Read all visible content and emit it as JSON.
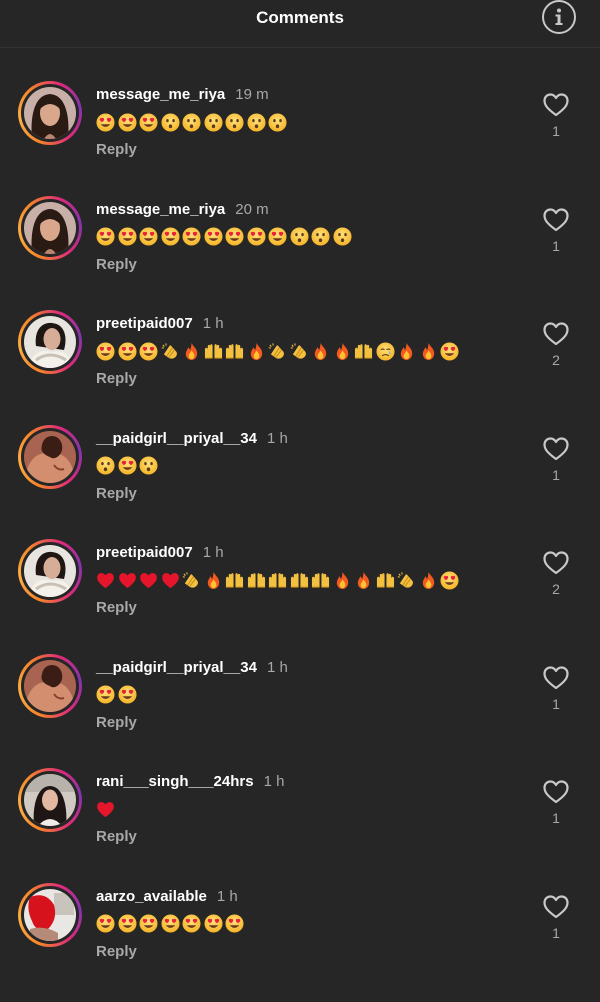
{
  "header": {
    "title": "Comments",
    "info_icon": "info-icon"
  },
  "colors": {
    "background": "#262626",
    "ring_gradient": [
      "#f58529",
      "#dd2a7b",
      "#8134af"
    ],
    "muted_text": "#a8a8a8"
  },
  "comments": [
    {
      "username": "message_me_riya",
      "time": "19 m",
      "reply_label": "Reply",
      "likes": "1",
      "avatar": "portrait-woman-dark-hair",
      "emojis": [
        "heart-eyes",
        "heart-eyes",
        "heart-eyes",
        "astonished",
        "astonished",
        "astonished",
        "astonished",
        "astonished",
        "astonished"
      ]
    },
    {
      "username": "message_me_riya",
      "time": "20 m",
      "reply_label": "Reply",
      "likes": "1",
      "avatar": "portrait-woman-dark-hair",
      "emojis": [
        "heart-eyes",
        "heart-eyes",
        "heart-eyes",
        "heart-eyes",
        "heart-eyes",
        "heart-eyes",
        "heart-eyes",
        "heart-eyes",
        "heart-eyes",
        "astonished",
        "astonished",
        "astonished"
      ]
    },
    {
      "username": "preetipaid007",
      "time": "1 h",
      "reply_label": "Reply",
      "likes": "2",
      "avatar": "portrait-woman-scarf",
      "emojis": [
        "heart-eyes",
        "heart-eyes",
        "heart-eyes",
        "clap",
        "fire",
        "raised-hands",
        "raised-hands",
        "fire",
        "clap",
        "clap",
        "fire",
        "fire",
        "raised-hands",
        "crying",
        "fire",
        "fire",
        "heart-eyes"
      ]
    },
    {
      "username": "__paidgirl__priyal__34",
      "time": "1 h",
      "reply_label": "Reply",
      "likes": "1",
      "avatar": "portrait-back",
      "emojis": [
        "astonished",
        "heart-eyes",
        "astonished"
      ]
    },
    {
      "username": "preetipaid007",
      "time": "1 h",
      "reply_label": "Reply",
      "likes": "2",
      "avatar": "portrait-woman-scarf",
      "emojis": [
        "red-heart",
        "red-heart",
        "red-heart",
        "red-heart",
        "clap",
        "fire",
        "raised-hands",
        "raised-hands",
        "raised-hands",
        "raised-hands",
        "raised-hands",
        "fire",
        "fire",
        "raised-hands",
        "clap",
        "fire",
        "heart-eyes"
      ]
    },
    {
      "username": "__paidgirl__priyal__34",
      "time": "1 h",
      "reply_label": "Reply",
      "likes": "1",
      "avatar": "portrait-back",
      "emojis": [
        "heart-eyes",
        "heart-eyes"
      ]
    },
    {
      "username": "rani___singh___24hrs",
      "time": "1 h",
      "reply_label": "Reply",
      "likes": "1",
      "avatar": "portrait-selfie",
      "emojis": [
        "red-heart"
      ]
    },
    {
      "username": "aarzo_available",
      "time": "1 h",
      "reply_label": "Reply",
      "likes": "1",
      "avatar": "portrait-red",
      "emojis": [
        "heart-eyes",
        "heart-eyes",
        "heart-eyes",
        "heart-eyes",
        "heart-eyes",
        "heart-eyes",
        "heart-eyes"
      ]
    }
  ]
}
